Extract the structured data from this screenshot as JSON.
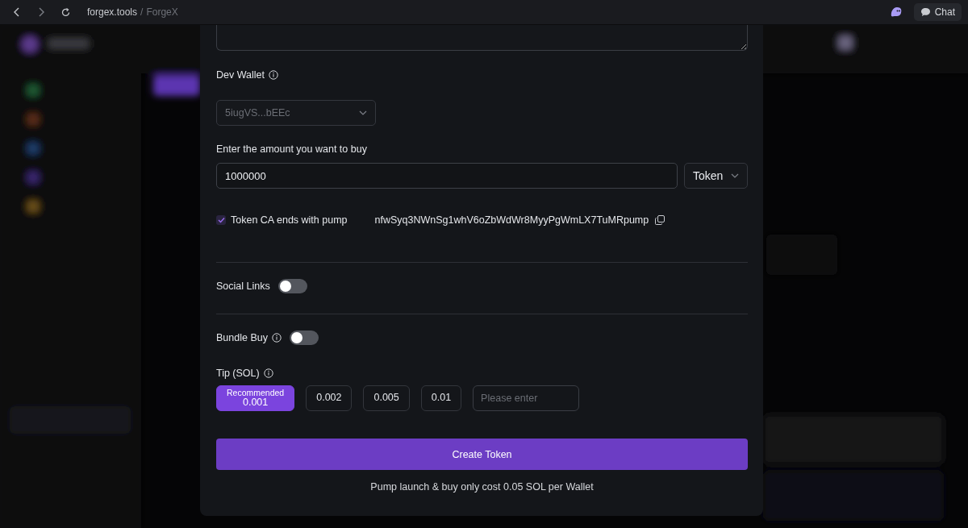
{
  "browser": {
    "host": "forgex.tools",
    "separator": "/",
    "page_title": "ForgeX",
    "chat_button": "Chat"
  },
  "form": {
    "dev_wallet": {
      "label": "Dev Wallet",
      "value": "5iugVS...bEEc",
      "disabled": true
    },
    "amount": {
      "label": "Enter the amount you want to buy",
      "value": "1000000",
      "unit": "Token"
    },
    "ca_option": {
      "label": "Token CA ends with pump",
      "checked": true,
      "address": "nfwSyq3NWnSg1whV6oZbWdWr8MyyPgWmLX7TuMRpump"
    },
    "toggles": [
      {
        "label": "Social Links",
        "on": false,
        "info": false
      },
      {
        "label": "Bundle Buy",
        "on": false,
        "info": true
      }
    ],
    "tip": {
      "label": "Tip (SOL)",
      "options": [
        {
          "badge": "Recommended",
          "value": "0.001",
          "selected": true
        },
        {
          "value": "0.002",
          "selected": false
        },
        {
          "value": "0.005",
          "selected": false
        },
        {
          "value": "0.01",
          "selected": false
        }
      ],
      "custom_placeholder": "Please enter"
    },
    "submit": "Create Token",
    "note": "Pump launch & buy only cost 0.05 SOL per Wallet"
  }
}
